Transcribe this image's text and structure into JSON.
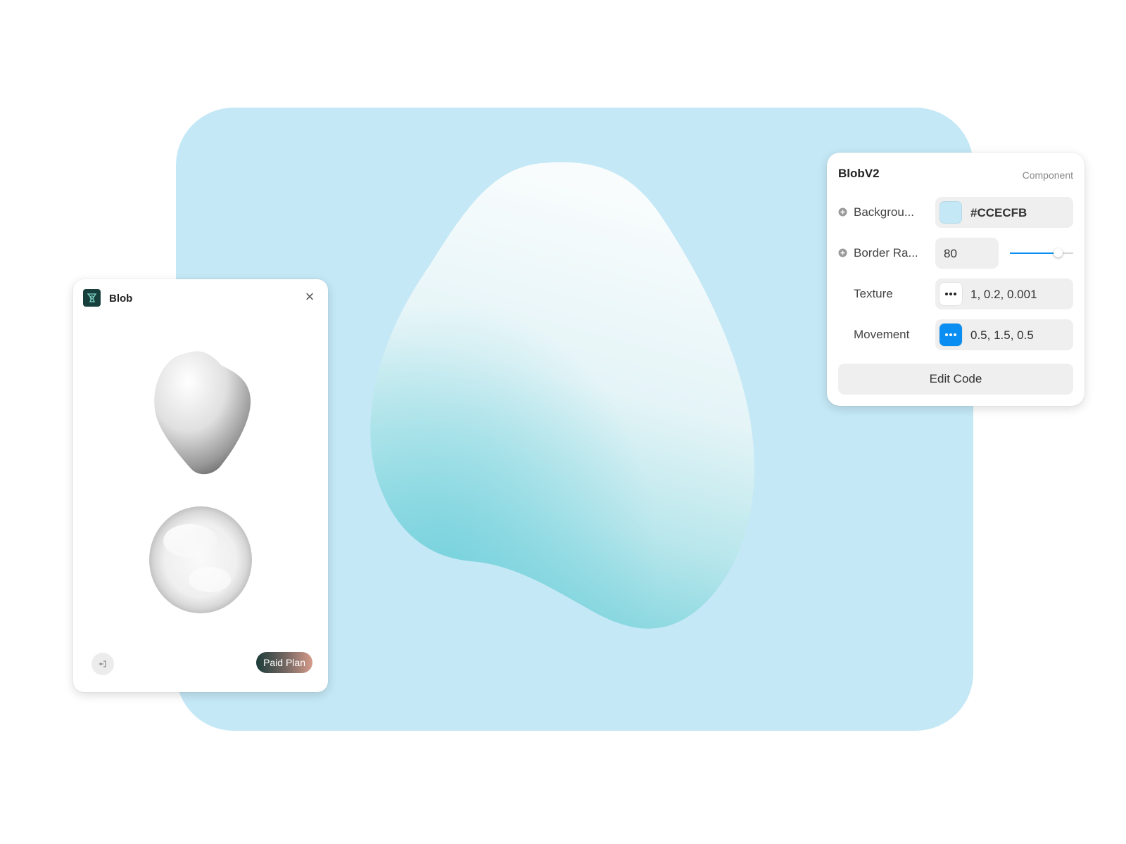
{
  "plugin": {
    "title": "Blob",
    "close_icon": "×",
    "paid_plan_label": "Paid Plan"
  },
  "panel": {
    "title": "BlobV2",
    "type_label": "Component",
    "rows": [
      {
        "label": "Backgrou...",
        "value": "#CCECFB",
        "swatch_color": "#c4e8f6"
      },
      {
        "label": "Border Ra...",
        "value": "80",
        "slider_fraction": 0.76
      },
      {
        "label": "Texture",
        "value": "1, 0.2, 0.001"
      },
      {
        "label": "Movement",
        "value": "0.5, 1.5, 0.5"
      }
    ],
    "edit_code_label": "Edit Code"
  },
  "colors": {
    "canvas_bg": "#c4e8f6",
    "accent_blue": "#0a8ef2",
    "logo_bg": "#17403c"
  }
}
